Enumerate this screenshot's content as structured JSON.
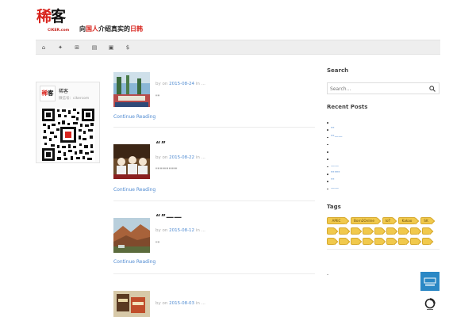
{
  "header": {
    "logo_prefix": "稀",
    "logo_suffix": "客",
    "logo_sub": "CIKER.com",
    "slogan_a": "向",
    "slogan_b": "国人",
    "slogan_c": "介绍真实的",
    "slogan_d": "日韩"
  },
  "nav": {
    "items": [
      {
        "icon": "home-icon",
        "glyph": "⌂"
      },
      {
        "icon": "android-icon",
        "glyph": "✦"
      },
      {
        "icon": "windows-icon",
        "glyph": "⊞"
      },
      {
        "icon": "monitor-icon",
        "glyph": "▤"
      },
      {
        "icon": "printer-icon",
        "glyph": "▣"
      },
      {
        "icon": "dollar-icon",
        "glyph": "$"
      }
    ]
  },
  "wechat": {
    "name": "稀客",
    "id": "微信号：cikercom"
  },
  "posts": [
    {
      "title": "",
      "meta_prefix": "by  on ",
      "date": "2015-08-24",
      "meta_suffix": " in ...",
      "excerpt": "\"\"",
      "more": "Continue Reading"
    },
    {
      "title": "“”",
      "meta_prefix": "by  on ",
      "date": "2015-08-22",
      "meta_suffix": " in ...",
      "excerpt": "\"\"\"\"\"\"\"\"\"\"",
      "more": "Continue Reading"
    },
    {
      "title": "“”——",
      "meta_prefix": "by  on ",
      "date": "2015-08-12",
      "meta_suffix": " in ...",
      "excerpt": "\"\"",
      "more": "Continue Reading"
    },
    {
      "title": "",
      "meta_prefix": "by  on ",
      "date": "2015-08-03",
      "meta_suffix": " in ...",
      "excerpt": "",
      "more": ""
    }
  ],
  "sidebar": {
    "search_title": "Search",
    "search_placeholder": "Search...",
    "recent_title": "Recent Posts",
    "recent": [
      "",
      "\"\"",
      "\"\"——",
      "",
      "",
      "",
      "——",
      "\"\"\"\"\"",
      "\"\"",
      "——"
    ],
    "tags_title": "Tags",
    "tags": [
      "APEC",
      "Born2Online",
      "IoT",
      "Kakao",
      "SK",
      "",
      "",
      "",
      "",
      "",
      "",
      "",
      "",
      "",
      "",
      "",
      "",
      "",
      "",
      "",
      "",
      "",
      ""
    ],
    "misc_dot": "-"
  },
  "colors": {
    "brand_red": "#d8231c",
    "link_blue": "#4f8ad1",
    "tag_yellow": "#f1c94c",
    "nav_bg": "#eeeeee"
  }
}
